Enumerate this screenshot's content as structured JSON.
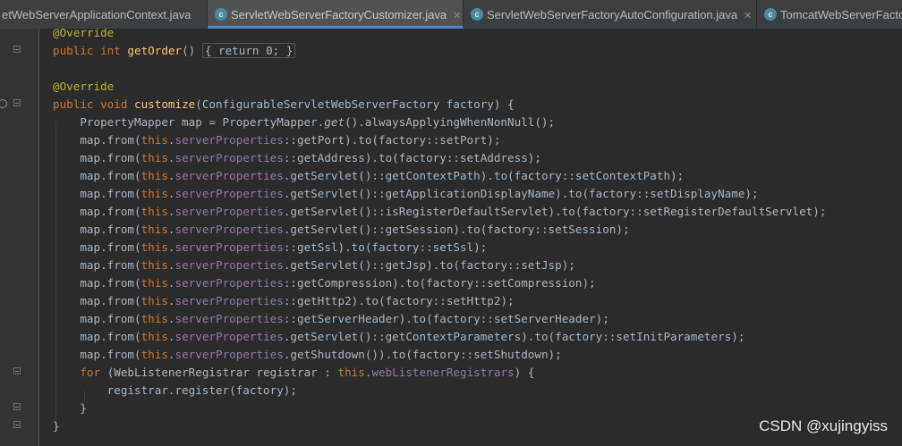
{
  "tabs": [
    {
      "label": "etWebServerApplicationContext.java",
      "active": false,
      "closable": false
    },
    {
      "label": "ServletWebServerFactoryCustomizer.java",
      "active": true,
      "closable": true
    },
    {
      "label": "ServletWebServerFactoryAutoConfiguration.java",
      "active": false,
      "closable": true
    },
    {
      "label": "TomcatWebServerFactoryCustomizer.java",
      "active": false,
      "closable": false
    }
  ],
  "icons": {
    "class_icon": "class-c-icon",
    "close_icon": "close-icon",
    "fold_icon": "fold-marker-icon",
    "implements_icon": "implements-gutter-icon"
  },
  "colors": {
    "keyword": "#cc7832",
    "annotation": "#bbb529",
    "method": "#ffc66d",
    "field": "#9876aa",
    "number": "#6897bb",
    "text": "#a9b7c6",
    "background": "#2b2b2b"
  },
  "code_lines": [
    [
      [
        "ann",
        "@Override"
      ]
    ],
    [
      [
        "kw",
        "public int "
      ],
      [
        "fn",
        "getOrder"
      ],
      [
        "p",
        "() "
      ],
      [
        "brk",
        "{ return 0; }"
      ]
    ],
    [],
    [
      [
        "ann",
        "@Override"
      ]
    ],
    [
      [
        "kw",
        "public void "
      ],
      [
        "fn",
        "customize"
      ],
      [
        "p",
        "(ConfigurableServletWebServerFactory factory) {"
      ]
    ],
    [
      [
        "p",
        "    PropertyMapper map = PropertyMapper."
      ],
      [
        "it",
        "get"
      ],
      [
        "p",
        "().alwaysApplyingWhenNonNull();"
      ]
    ],
    [
      [
        "p",
        "    map.from("
      ],
      [
        "kw",
        "this"
      ],
      [
        "p",
        "."
      ],
      [
        "fld",
        "serverProperties"
      ],
      [
        "p",
        "::getPort).to(factory::setPort);"
      ]
    ],
    [
      [
        "p",
        "    map.from("
      ],
      [
        "kw",
        "this"
      ],
      [
        "p",
        "."
      ],
      [
        "fld",
        "serverProperties"
      ],
      [
        "p",
        "::getAddress).to(factory::setAddress);"
      ]
    ],
    [
      [
        "p",
        "    map.from("
      ],
      [
        "kw",
        "this"
      ],
      [
        "p",
        "."
      ],
      [
        "fld",
        "serverProperties"
      ],
      [
        "p",
        ".getServlet()::getContextPath).to(factory::setContextPath);"
      ]
    ],
    [
      [
        "p",
        "    map.from("
      ],
      [
        "kw",
        "this"
      ],
      [
        "p",
        "."
      ],
      [
        "fld",
        "serverProperties"
      ],
      [
        "p",
        ".getServlet()::getApplicationDisplayName).to(factory::setDisplayName);"
      ]
    ],
    [
      [
        "p",
        "    map.from("
      ],
      [
        "kw",
        "this"
      ],
      [
        "p",
        "."
      ],
      [
        "fld",
        "serverProperties"
      ],
      [
        "p",
        ".getServlet()::isRegisterDefaultServlet).to(factory::setRegisterDefaultServlet);"
      ]
    ],
    [
      [
        "p",
        "    map.from("
      ],
      [
        "kw",
        "this"
      ],
      [
        "p",
        "."
      ],
      [
        "fld",
        "serverProperties"
      ],
      [
        "p",
        ".getServlet()::getSession).to(factory::setSession);"
      ]
    ],
    [
      [
        "p",
        "    map.from("
      ],
      [
        "kw",
        "this"
      ],
      [
        "p",
        "."
      ],
      [
        "fld",
        "serverProperties"
      ],
      [
        "p",
        "::getSsl).to(factory::setSsl);"
      ]
    ],
    [
      [
        "p",
        "    map.from("
      ],
      [
        "kw",
        "this"
      ],
      [
        "p",
        "."
      ],
      [
        "fld",
        "serverProperties"
      ],
      [
        "p",
        ".getServlet()::getJsp).to(factory::setJsp);"
      ]
    ],
    [
      [
        "p",
        "    map.from("
      ],
      [
        "kw",
        "this"
      ],
      [
        "p",
        "."
      ],
      [
        "fld",
        "serverProperties"
      ],
      [
        "p",
        "::getCompression).to(factory::setCompression);"
      ]
    ],
    [
      [
        "p",
        "    map.from("
      ],
      [
        "kw",
        "this"
      ],
      [
        "p",
        "."
      ],
      [
        "fld",
        "serverProperties"
      ],
      [
        "p",
        "::getHttp2).to(factory::setHttp2);"
      ]
    ],
    [
      [
        "p",
        "    map.from("
      ],
      [
        "kw",
        "this"
      ],
      [
        "p",
        "."
      ],
      [
        "fld",
        "serverProperties"
      ],
      [
        "p",
        "::getServerHeader).to(factory::setServerHeader);"
      ]
    ],
    [
      [
        "p",
        "    map.from("
      ],
      [
        "kw",
        "this"
      ],
      [
        "p",
        "."
      ],
      [
        "fld",
        "serverProperties"
      ],
      [
        "p",
        ".getServlet()::getContextParameters).to(factory::setInitParameters);"
      ]
    ],
    [
      [
        "p",
        "    map.from("
      ],
      [
        "kw",
        "this"
      ],
      [
        "p",
        "."
      ],
      [
        "fld",
        "serverProperties"
      ],
      [
        "p",
        ".getShutdown()).to(factory::setShutdown);"
      ]
    ],
    [
      [
        "p",
        "    "
      ],
      [
        "kw",
        "for "
      ],
      [
        "p",
        "(WebListenerRegistrar registrar : "
      ],
      [
        "kw",
        "this"
      ],
      [
        "p",
        "."
      ],
      [
        "fld",
        "webListenerRegistrars"
      ],
      [
        "p",
        ") {"
      ]
    ],
    [
      [
        "p",
        "        registrar.register(factory);"
      ]
    ],
    [
      [
        "p",
        "    }"
      ]
    ],
    [
      [
        "p",
        "}"
      ]
    ]
  ],
  "watermark": "CSDN @xujingyiss"
}
